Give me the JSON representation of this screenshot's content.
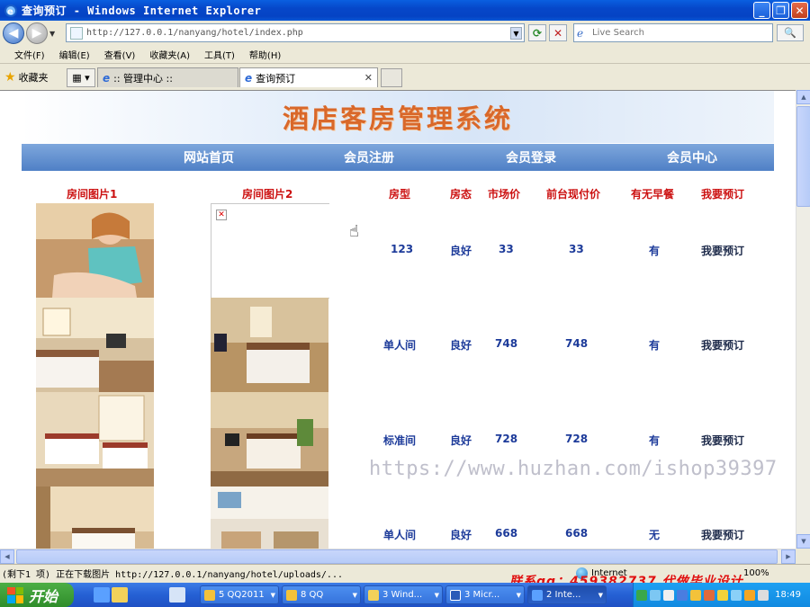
{
  "window": {
    "title": "查询预订 - Windows Internet Explorer"
  },
  "toolbar": {
    "url": "http://127.0.0.1/nanyang/hotel/index.php",
    "search_placeholder": "Live Search"
  },
  "menu": [
    "文件(F)",
    "编辑(E)",
    "查看(V)",
    "收藏夹(A)",
    "工具(T)",
    "帮助(H)"
  ],
  "favorites_label": "收藏夹",
  "tabs": [
    {
      "label": ":: 管理中心 ::",
      "active": false
    },
    {
      "label": "查询预订",
      "active": true
    }
  ],
  "site": {
    "title": "酒店客房管理系统",
    "nav": [
      "网站首页",
      "会员注册",
      "会员登录",
      "会员中心"
    ]
  },
  "table": {
    "headers": [
      "房间图片1",
      "房间图片2",
      "房型",
      "房态",
      "市场价",
      "前台现付价",
      "有无早餐",
      "我要预订"
    ],
    "rows": [
      {
        "type": "123",
        "status": "良好",
        "market": "33",
        "front": "33",
        "breakfast": "有",
        "book": "我要预订"
      },
      {
        "type": "单人间",
        "status": "良好",
        "market": "748",
        "front": "748",
        "breakfast": "有",
        "book": "我要预订"
      },
      {
        "type": "标准间",
        "status": "良好",
        "market": "728",
        "front": "728",
        "breakfast": "有",
        "book": "我要预订"
      },
      {
        "type": "单人间",
        "status": "良好",
        "market": "668",
        "front": "668",
        "breakfast": "无",
        "book": "我要预订"
      }
    ]
  },
  "watermark": "https://www.huzhan.com/ishop39397",
  "status": {
    "text": "(剩下1 项) 正在下载图片 http://127.0.0.1/nanyang/hotel/uploads/...",
    "zone": "Internet",
    "zoom": "100%",
    "promo": "联系qq：459382737 代做毕业设计"
  },
  "taskbar": {
    "start": "开始",
    "tasks": [
      "5 QQ2011",
      "8 QQ",
      "3 Wind...",
      "3 Micr...",
      "2 Inte..."
    ],
    "clock": "18:49"
  },
  "colors": {
    "header_red": "#cc1111",
    "cell_blue": "#1d3b9a",
    "title_orange": "#d9682a",
    "nav_blue": "#4f80c6"
  }
}
